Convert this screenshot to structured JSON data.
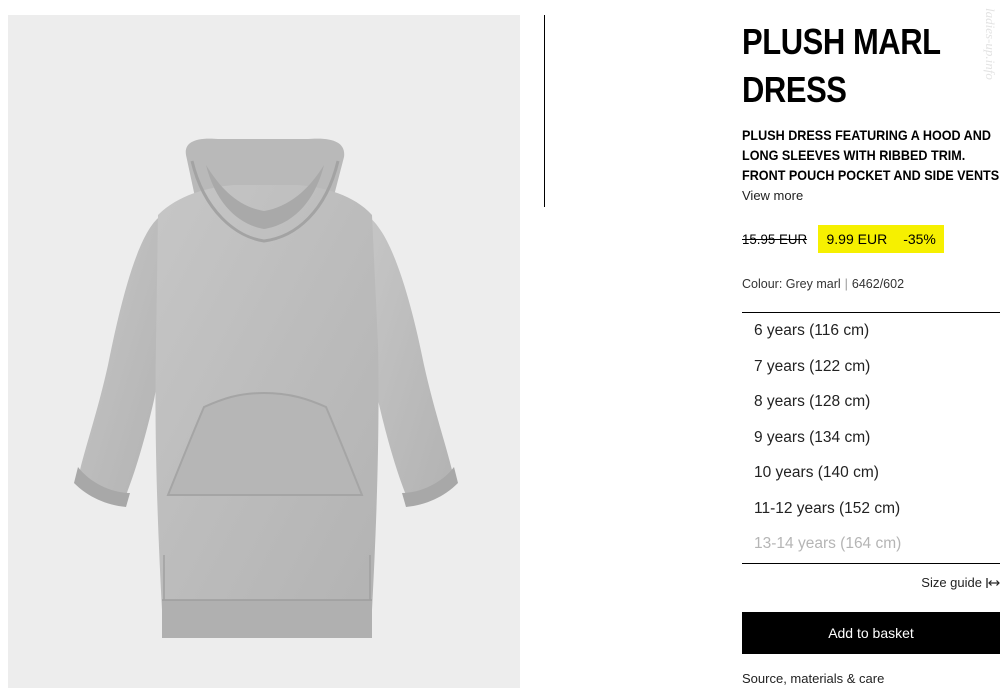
{
  "product": {
    "title_line1": "PLUSH MARL",
    "title_line2": "DRESS",
    "description_lines": [
      "PLUSH DRESS FEATURING A HOOD AND",
      "LONG SLEEVES WITH RIBBED TRIM.",
      "FRONT POUCH POCKET AND SIDE VENTS"
    ],
    "view_more": "View more",
    "price": {
      "old": "15.95 EUR",
      "new": "9.99 EUR",
      "discount": "-35%",
      "badge_color": "#f6f000"
    },
    "colour_label": "Colour: Grey marl",
    "ref": "6462/602",
    "sizes": [
      {
        "label": "6 years (116 cm)",
        "available": true
      },
      {
        "label": "7 years (122 cm)",
        "available": true
      },
      {
        "label": "8 years (128 cm)",
        "available": true
      },
      {
        "label": "9 years (134 cm)",
        "available": true
      },
      {
        "label": "10 years (140 cm)",
        "available": true
      },
      {
        "label": "11-12 years (152 cm)",
        "available": true
      },
      {
        "label": "13-14 years (164 cm)",
        "available": false
      }
    ],
    "size_guide": "Size guide",
    "size_guide_icon": "resize-horizontal-icon",
    "add_to_basket": "Add to basket",
    "care_link": "Source, materials & care"
  },
  "image": {
    "alt_subject": "grey hooded sweatshirt dress",
    "background_color": "#ededed",
    "garment_color": "#bdbdbd"
  },
  "watermark": "ladies-up.info"
}
